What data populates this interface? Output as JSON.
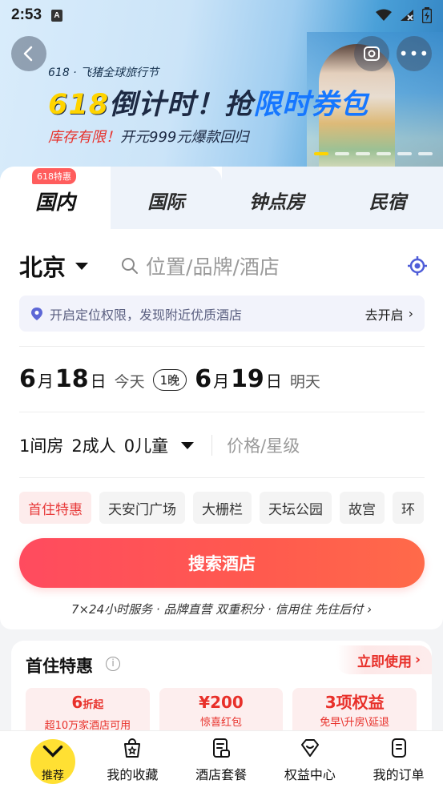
{
  "status_bar": {
    "time": "2:53",
    "notif_letter": "A"
  },
  "banner": {
    "brand": "618 · 飞猪全球旅行节",
    "headline_num": "618",
    "headline_mid": "倒计时！抢",
    "headline_blue": "限时券包",
    "sub_red": "库存有限！",
    "sub_rest": "开元999元爆款回归",
    "more_glyph": "•••"
  },
  "tabs": {
    "badge": "618特惠",
    "items": [
      {
        "label": "国内"
      },
      {
        "label": "国际"
      },
      {
        "label": "钟点房"
      },
      {
        "label": "民宿"
      }
    ]
  },
  "search": {
    "city": "北京",
    "placeholder": "位置/品牌/酒店"
  },
  "location_bar": {
    "message": "开启定位权限，发现附近优质酒店",
    "action": "去开启",
    "chevron": "›"
  },
  "dates": {
    "checkin_month": "6",
    "checkin_day": "18",
    "month_unit": "月",
    "day_unit": "日",
    "checkin_rel": "今天",
    "nights": "1晚",
    "checkout_month": "6",
    "checkout_day": "19",
    "checkout_rel": "明天"
  },
  "rooms": {
    "rooms": "1间房",
    "adults": "2成人",
    "children": "0儿童",
    "price_placeholder": "价格/星级"
  },
  "chips": [
    "首住特惠",
    "天安门广场",
    "大栅栏",
    "天坛公园",
    "故宫",
    "环"
  ],
  "search_button": "搜索酒店",
  "service_line": "7×24小时服务 · 品牌直营 双重积分 · 信用住 先住后付 ›",
  "first_stay": {
    "title": "首住特惠",
    "use_now": "立即使用",
    "use_chev": "›",
    "benefits": [
      {
        "value": "6",
        "unit": "折起",
        "desc": "超10万家酒店可用"
      },
      {
        "value": "¥200",
        "unit": "",
        "desc": "惊喜红包"
      },
      {
        "value": "3项权益",
        "unit": "",
        "desc": "免早\\升房\\延退"
      }
    ]
  },
  "bottom_nav": {
    "recommend": "推荐",
    "items": [
      {
        "label": "我的收藏",
        "icon": "bag-star-icon"
      },
      {
        "label": "酒店套餐",
        "icon": "package-icon"
      },
      {
        "label": "权益中心",
        "icon": "diamond-icon"
      },
      {
        "label": "我的订单",
        "icon": "order-icon"
      }
    ]
  },
  "colors": {
    "accent": "#ff4b5f",
    "promo_red": "#e8302a",
    "brand_yellow": "#ffe033",
    "tab_bg": "#eef3fa"
  }
}
